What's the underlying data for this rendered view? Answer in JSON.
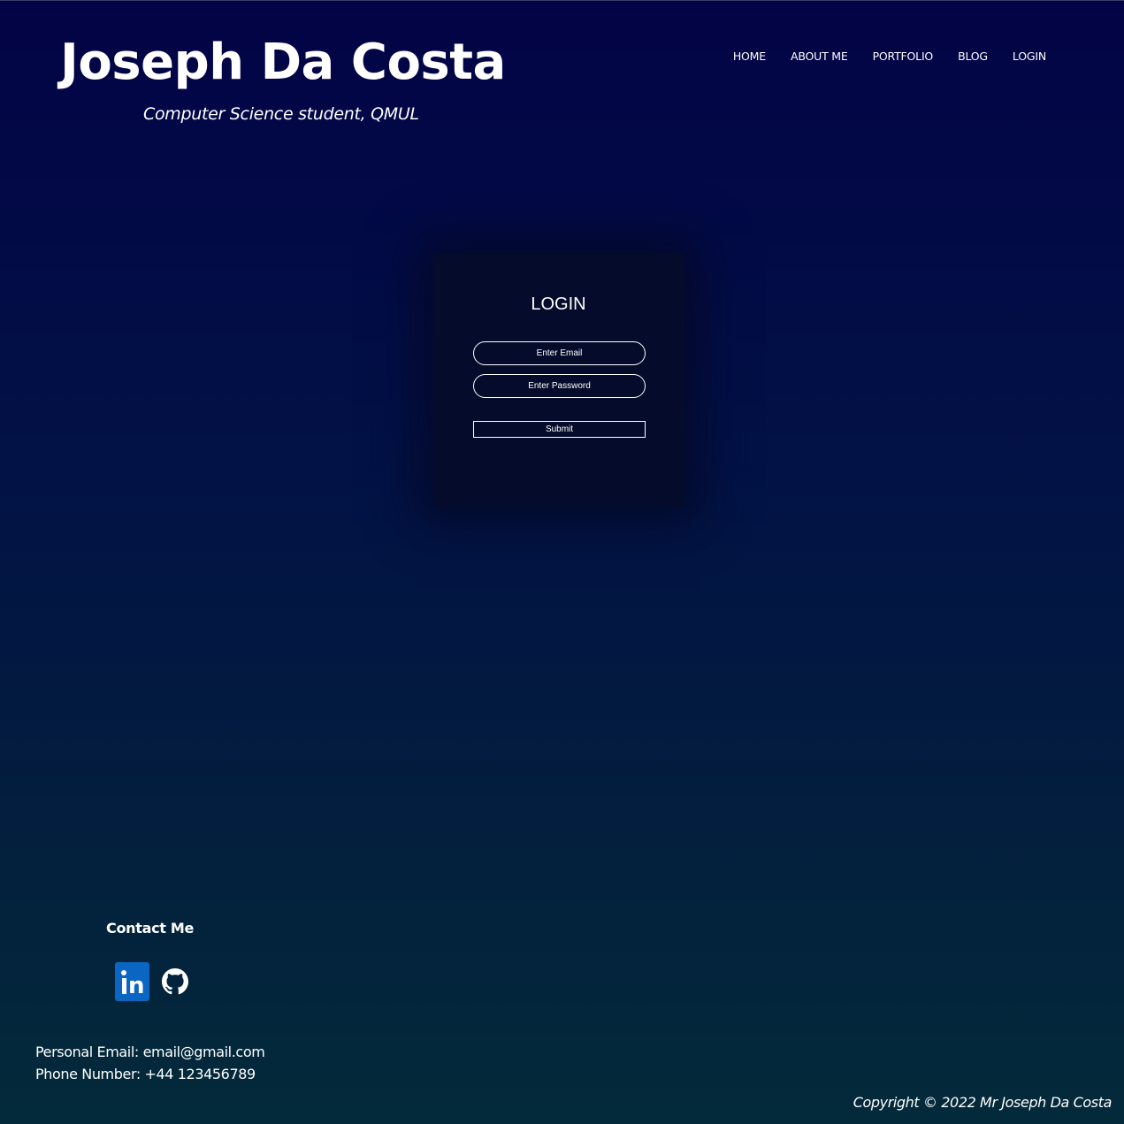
{
  "header": {
    "title": "Joseph Da Costa",
    "subtitle": "Computer Science student, QMUL"
  },
  "nav": {
    "items": [
      {
        "label": "HOME"
      },
      {
        "label": "ABOUT ME"
      },
      {
        "label": "PORTFOLIO"
      },
      {
        "label": "BLOG"
      },
      {
        "label": "LOGIN"
      }
    ]
  },
  "login": {
    "heading": "LOGIN",
    "email_placeholder": "Enter Email",
    "password_placeholder": "Enter Password",
    "submit_label": "Submit"
  },
  "footer": {
    "contact_heading": "Contact Me",
    "social_icons": [
      "linkedin-icon",
      "github-icon"
    ],
    "personal_email": "Personal Email: email@gmail.com",
    "phone_number": "Phone Number: +44 123456789",
    "copyright": "Copyright © 2022 Mr Joseph Da Costa"
  },
  "colors": {
    "background_top": "#020346",
    "background_bottom": "#032a3a",
    "card_background": "#050c2b",
    "linkedin_blue": "#0a66c2",
    "text": "#ffffff"
  }
}
